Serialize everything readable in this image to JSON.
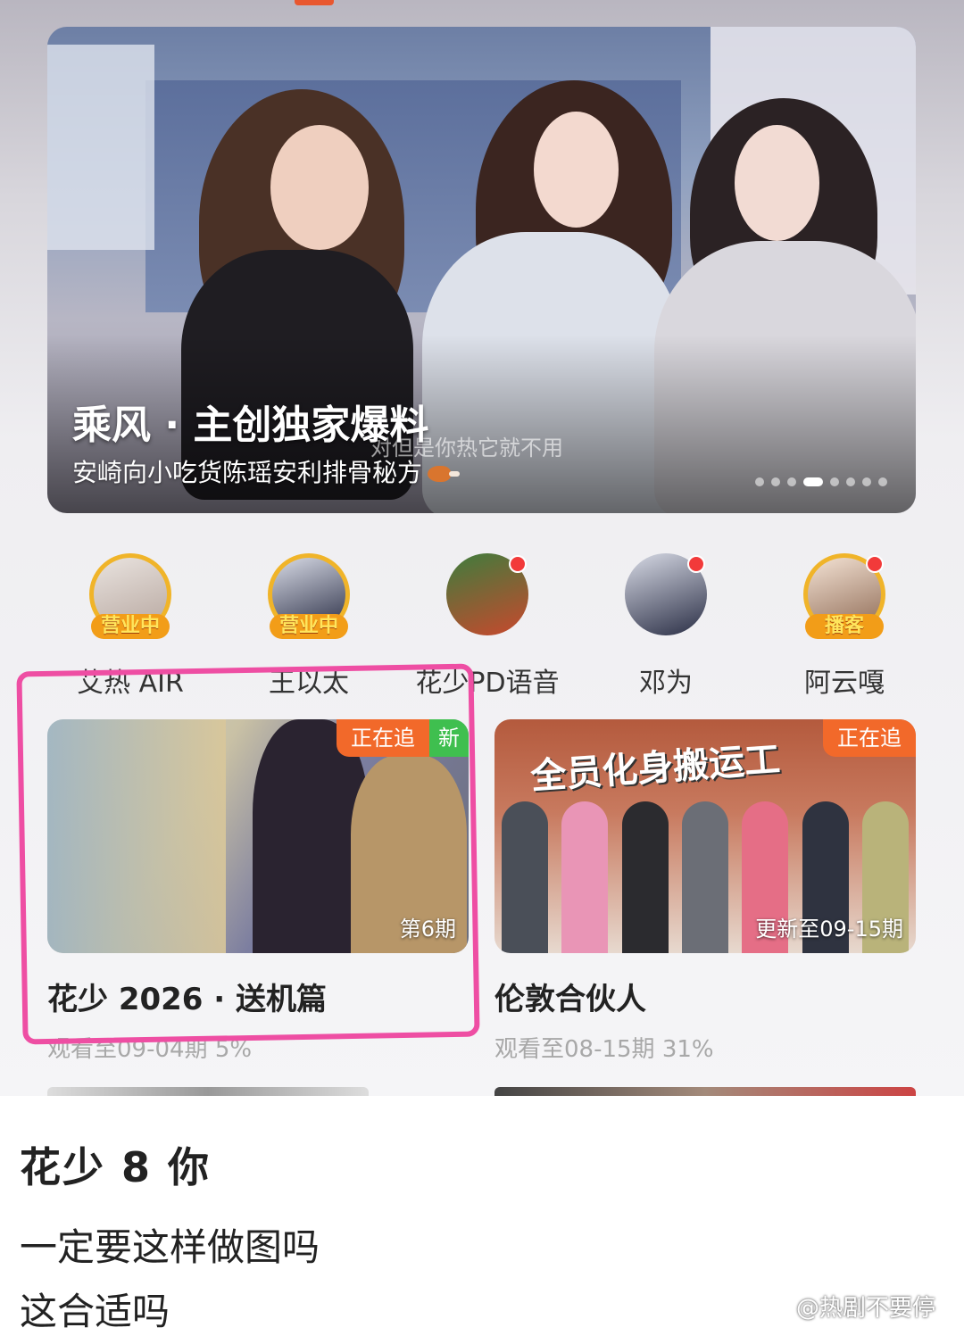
{
  "banner": {
    "title": "乘风 · 主创独家爆料",
    "subtitle": "安崎向小吃货陈瑶安利排骨秘方",
    "caption": "对但是你热它就不用"
  },
  "avatars": [
    {
      "name": "艾热 AIR",
      "badge": "营业中"
    },
    {
      "name": "王以太",
      "badge": "营业中"
    },
    {
      "name": "花少PD语音",
      "badge": ""
    },
    {
      "name": "邓为",
      "badge": ""
    },
    {
      "name": "阿云嘎",
      "badge": "播客"
    }
  ],
  "shows": [
    {
      "title": "花少 2026 · 送机篇",
      "progress": "观看至09-04期 5%",
      "tag_follow": "正在追",
      "tag_new": "新",
      "episode": "第6期"
    },
    {
      "title": "伦敦合伙人",
      "progress": "观看至08-15期 31%",
      "tag_follow": "正在追",
      "thumb_headline": "全员化身搬运工",
      "episode": "更新至09-15期"
    }
  ],
  "post": {
    "title": "花少 8 你",
    "lines": [
      "一定要这样做图吗",
      "这合适吗"
    ],
    "watermark": "@热剧不要停"
  },
  "colors": {
    "accent": "#f2692a",
    "badge": "#f29d18",
    "highlight": "#ee4ea3",
    "new_tag": "#3fbf4f"
  }
}
